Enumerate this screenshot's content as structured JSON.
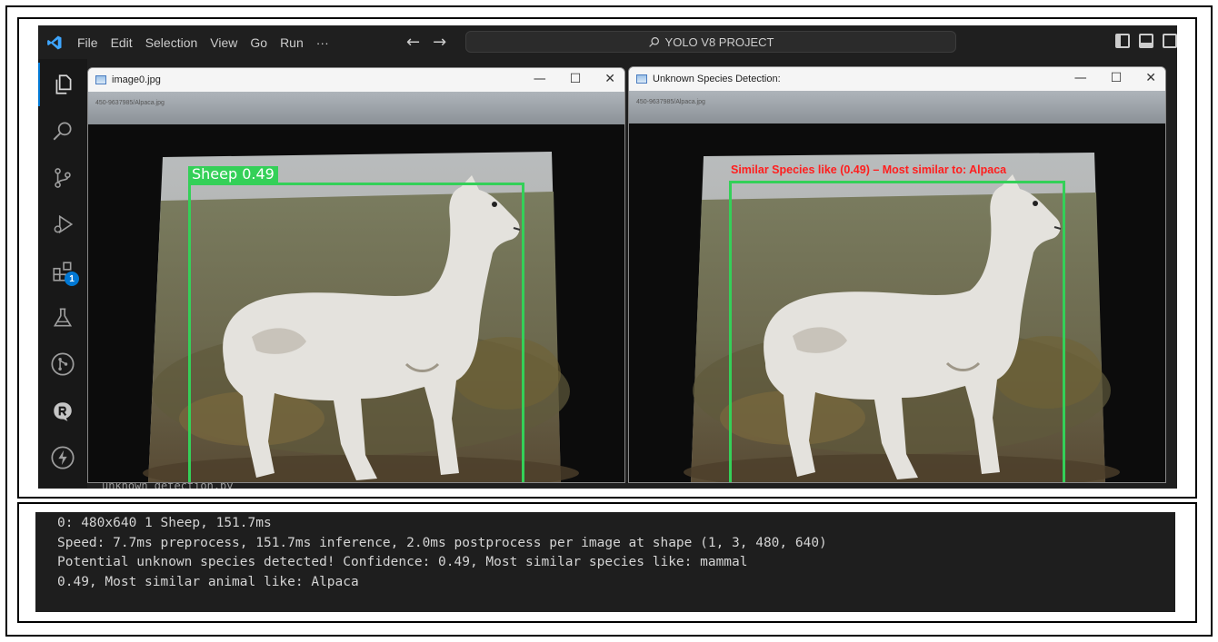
{
  "titlebar": {
    "menu": [
      "File",
      "Edit",
      "Selection",
      "View",
      "Go",
      "Run",
      "···"
    ],
    "search_text": "YOLO V8 PROJECT"
  },
  "activity_bar": {
    "icons": [
      "explorer-icon",
      "search-icon",
      "source-control-icon",
      "run-debug-icon",
      "extensions-icon",
      "testing-icon",
      "git-graph-icon",
      "r-icon",
      "thunder-icon"
    ],
    "extensions_badge": "1"
  },
  "editor": {
    "background_line": "unknown_detection.py"
  },
  "window_left": {
    "title": "image0.jpg",
    "screen_path": "450-9637985/Alpaca.jpg",
    "detection_label": "Sheep 0.49",
    "min": "—",
    "max": "☐",
    "close": "✕"
  },
  "window_right": {
    "title": "Unknown Species Detection:",
    "screen_path": "450-9637985/Alpaca.jpg",
    "detection_label": "Similar Species like (0.49) – Most similar to: Alpaca",
    "min": "—",
    "max": "☐",
    "close": "✕"
  },
  "terminal": {
    "lines": [
      "0: 480x640 1 Sheep, 151.7ms",
      "Speed: 7.7ms preprocess, 151.7ms inference, 2.0ms postprocess per image at shape (1, 3, 480, 640)",
      "Potential unknown species detected! Confidence: 0.49, Most similar species like: mammal",
      "0.49, Most similar animal like: Alpaca"
    ]
  },
  "colors": {
    "accent": "#0078d4",
    "detection_green": "#34d058",
    "unknown_red": "#ff1e1e"
  }
}
